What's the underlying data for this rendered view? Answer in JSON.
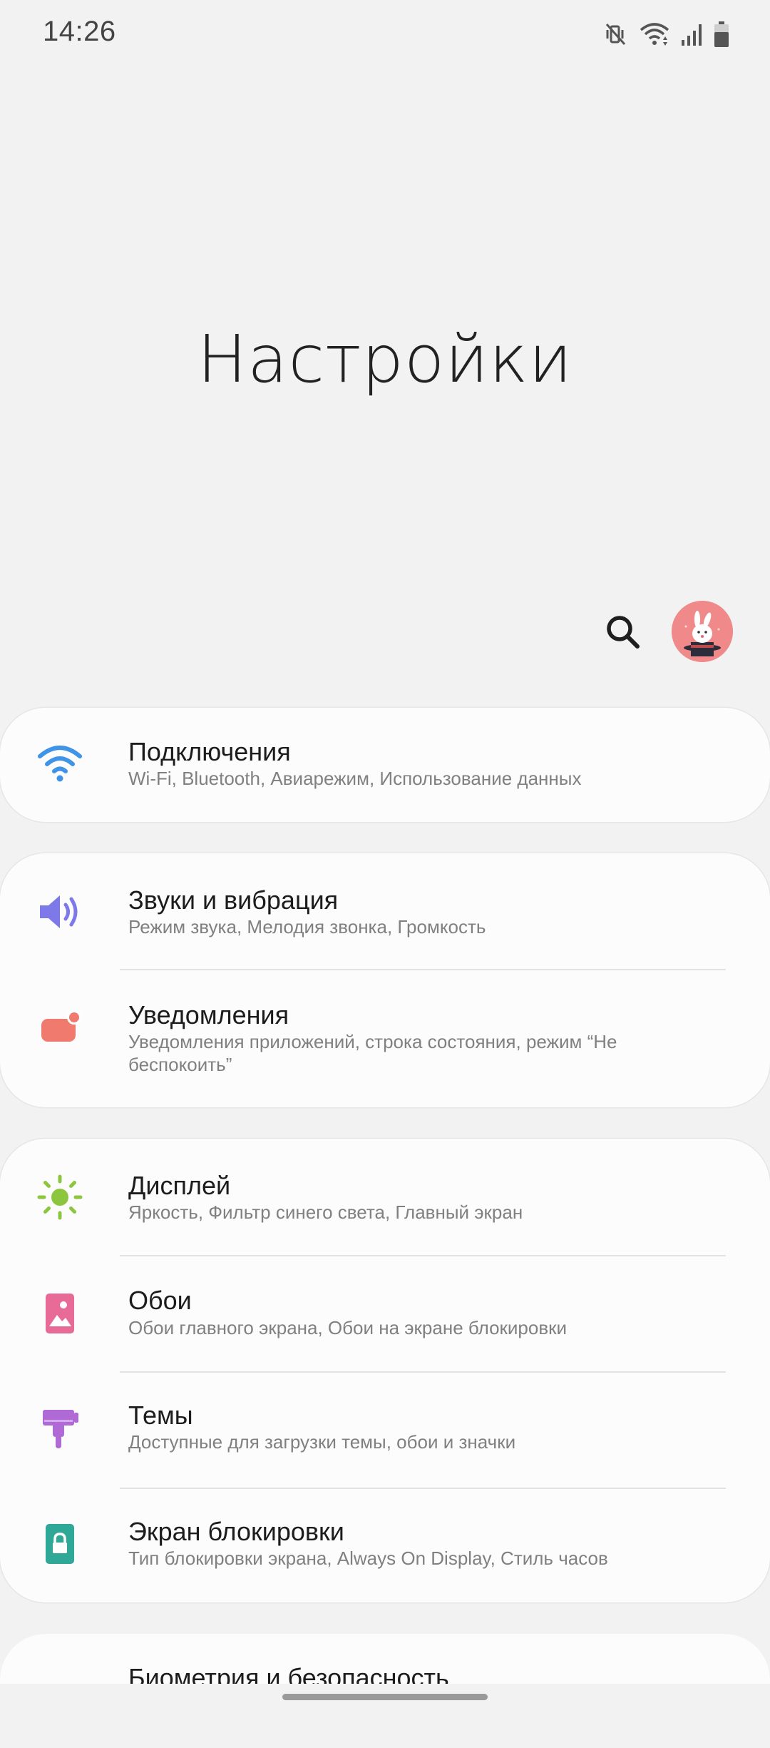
{
  "status_bar": {
    "time": "14:26",
    "icons": [
      "mute-vibrate-icon",
      "wifi-icon",
      "signal-icon",
      "battery-icon"
    ]
  },
  "header": {
    "title": "Настройки"
  },
  "toolbar": {
    "search_icon": "search-icon",
    "avatar_icon": "profile-avatar-icon"
  },
  "settings": {
    "connections": {
      "title": "Подключения",
      "subtitle": "Wi-Fi, Bluetooth, Авиарежим, Использование данных",
      "icon": "wifi-icon",
      "icon_color": "#3f94e8"
    },
    "sounds": {
      "title": "Звуки и вибрация",
      "subtitle": "Режим звука, Мелодия звонка, Громкость",
      "icon": "speaker-icon",
      "icon_color": "#7e79e8"
    },
    "notifications": {
      "title": "Уведомления",
      "subtitle": "Уведомления приложений, строка состояния, режим “Не беспокоить”",
      "icon": "notification-icon",
      "icon_color": "#f07a6e"
    },
    "display": {
      "title": "Дисплей",
      "subtitle": "Яркость, Фильтр синего света, Главный экран",
      "icon": "brightness-icon",
      "icon_color": "#8cc63e"
    },
    "wallpapers": {
      "title": "Обои",
      "subtitle": "Обои главного экрана, Обои на экране блокировки",
      "icon": "wallpaper-icon",
      "icon_color": "#e86a96"
    },
    "themes": {
      "title": "Темы",
      "subtitle": "Доступные для загрузки темы, обои и значки",
      "icon": "brush-icon",
      "icon_color": "#b06ad6"
    },
    "lockscreen": {
      "title": "Экран блокировки",
      "subtitle": "Тип блокировки экрана, Always On Display, Стиль часов",
      "icon": "lock-icon",
      "icon_color": "#2fa897"
    },
    "biometrics": {
      "title": "Биометрия и безопасность"
    }
  }
}
